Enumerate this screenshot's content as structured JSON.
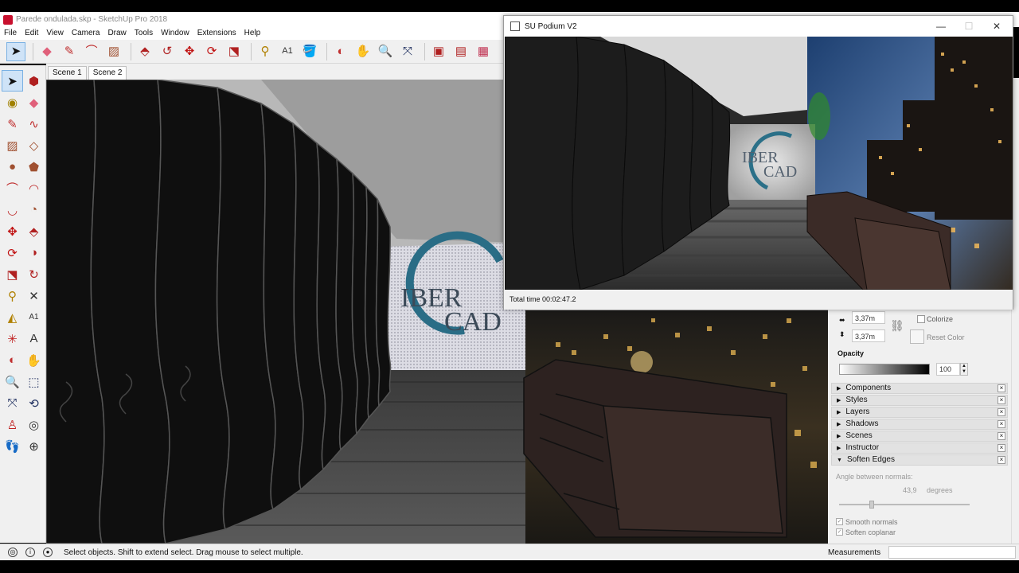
{
  "window": {
    "title": "Parede ondulada.skp - SketchUp Pro 2018"
  },
  "menu": [
    "File",
    "Edit",
    "View",
    "Camera",
    "Draw",
    "Tools",
    "Window",
    "Extensions",
    "Help"
  ],
  "toolbar": {
    "icons": [
      "select-icon",
      "eraser-icon",
      "pencil-icon",
      "arc-icon",
      "rectangle-icon",
      "pushpull-icon",
      "followme-icon",
      "move-icon",
      "rotate-icon",
      "scale-icon",
      "tape-icon",
      "text-icon",
      "paint-icon",
      "orbit-icon",
      "pan-icon",
      "zoom-icon",
      "zoom-extents-icon",
      "warehouse-icon",
      "extension-warehouse-icon",
      "send-to-layout-icon"
    ]
  },
  "scenes": {
    "tabs": [
      "Scene 1",
      "Scene 2"
    ],
    "active": "Scene 2"
  },
  "viewport": {
    "logo_line1": "IBER",
    "logo_line2": "CAD"
  },
  "podium": {
    "title": "SU Podium V2",
    "status": "Total time 00:02:47.2",
    "logo_line1": "IBER",
    "logo_line2": "CAD"
  },
  "tray": {
    "width_value": "3,37m",
    "height_value": "3,37m",
    "colorize_label": "Colorize",
    "reset_color_label": "Reset Color",
    "opacity_label": "Opacity",
    "opacity_value": "100",
    "panels": [
      "Components",
      "Styles",
      "Layers",
      "Shadows",
      "Scenes",
      "Instructor",
      "Soften Edges"
    ],
    "soften": {
      "angle_label": "Angle between normals:",
      "angle_value": "43,9",
      "angle_unit": "degrees",
      "smooth_normals": "Smooth normals",
      "soften_coplanar": "Soften coplanar"
    }
  },
  "statusbar": {
    "message": "Select objects. Shift to extend select. Drag mouse to select multiple.",
    "measurements_label": "Measurements"
  }
}
